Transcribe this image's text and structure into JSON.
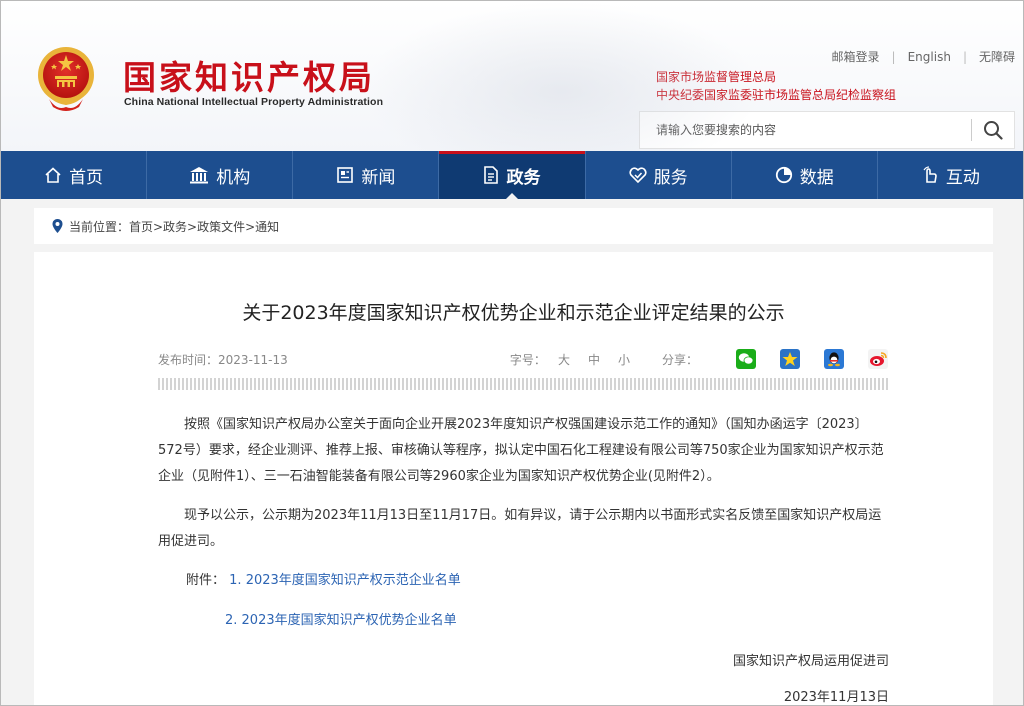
{
  "header": {
    "site_name_cn": "国家知识产权局",
    "site_name_en": "China National Intellectual Property Administration",
    "links": [
      "邮箱登录",
      "English",
      "无障碍"
    ],
    "org_line1": "国家市场监督管理总局",
    "org_line2": "中央纪委国家监委驻市场监管总局纪检监察组",
    "search_placeholder": "请输入您要搜索的内容",
    "brand_color": "#c8101a"
  },
  "nav": {
    "items": [
      {
        "label": "首页",
        "icon": "home-icon"
      },
      {
        "label": "机构",
        "icon": "institution-icon"
      },
      {
        "label": "新闻",
        "icon": "news-icon"
      },
      {
        "label": "政务",
        "icon": "document-icon",
        "active": true
      },
      {
        "label": "服务",
        "icon": "service-icon"
      },
      {
        "label": "数据",
        "icon": "chart-icon"
      },
      {
        "label": "互动",
        "icon": "hand-icon"
      }
    ],
    "color": "#1d4e8f"
  },
  "breadcrumb": {
    "text": "当前位置：首页>政务>政策文件>通知"
  },
  "article": {
    "title": "关于2023年度国家知识产权优势企业和示范企业评定结果的公示",
    "date_label": "发布时间：2023-11-13",
    "font_size_label": "字号：",
    "font_sizes": [
      "大",
      "中",
      "小"
    ],
    "share_label": "分享：",
    "share_icons": [
      "wechat-icon",
      "favorite-icon",
      "qq-icon",
      "weibo-icon"
    ],
    "paragraph1": "按照《国家知识产权局办公室关于面向企业开展2023年度知识产权强国建设示范工作的通知》（国知办函运字〔2023〕572号）要求，经企业测评、推荐上报、审核确认等程序，拟认定中国石化工程建设有限公司等750家企业为国家知识产权示范企业（见附件1）、三一石油智能装备有限公司等2960家企业为国家知识产权优势企业(见附件2）。",
    "paragraph2": "现予以公示，公示期为2023年11月13日至11月17日。如有异议，请于公示期内以书面形式实名反馈至国家知识产权局运用促进司。",
    "attachment_label": "附件：",
    "attachment1": "1. 2023年度国家知识产权示范企业名单",
    "attachment2": "2. 2023年度国家知识产权优势企业名单",
    "signature": "国家知识产权局运用促进司",
    "sign_date": "2023年11月13日"
  }
}
